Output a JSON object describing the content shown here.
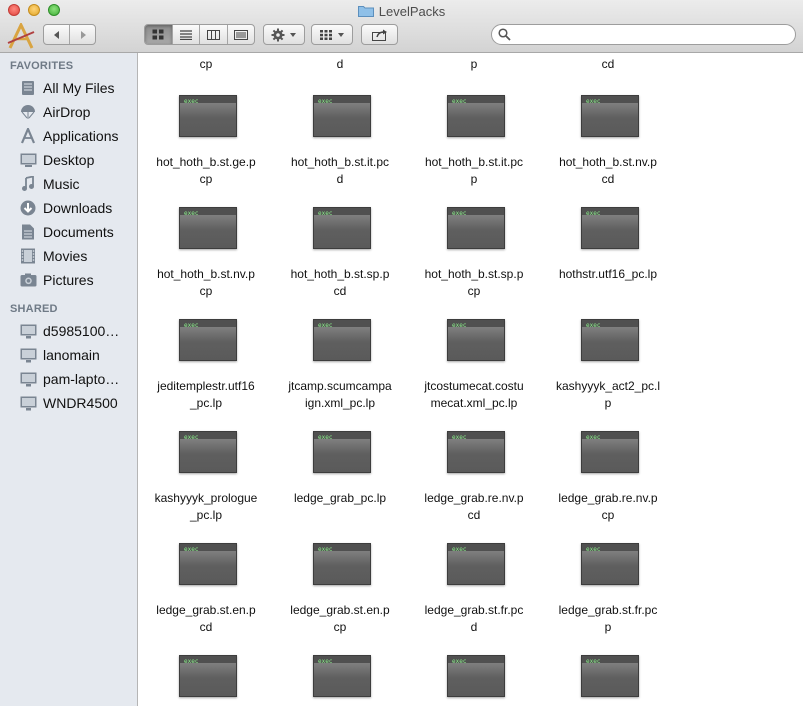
{
  "window": {
    "title": "LevelPacks"
  },
  "search": {
    "placeholder": ""
  },
  "sidebar": {
    "favorites_header": "FAVORITES",
    "favorites": [
      {
        "label": "All My Files",
        "icon": "all-files-icon"
      },
      {
        "label": "AirDrop",
        "icon": "airdrop-icon"
      },
      {
        "label": "Applications",
        "icon": "applications-icon"
      },
      {
        "label": "Desktop",
        "icon": "desktop-icon"
      },
      {
        "label": "Music",
        "icon": "music-icon"
      },
      {
        "label": "Downloads",
        "icon": "downloads-icon"
      },
      {
        "label": "Documents",
        "icon": "documents-icon"
      },
      {
        "label": "Movies",
        "icon": "movies-icon"
      },
      {
        "label": "Pictures",
        "icon": "pictures-icon"
      }
    ],
    "shared_header": "SHARED",
    "shared": [
      {
        "label": "d5985100…",
        "icon": "computer-icon"
      },
      {
        "label": "lanomain",
        "icon": "computer-icon"
      },
      {
        "label": "pam-lapto…",
        "icon": "computer-icon"
      },
      {
        "label": "WNDR4500",
        "icon": "computer-icon"
      }
    ]
  },
  "files": {
    "thumb_label": "exec",
    "top_partial": [
      {
        "line2": "cp"
      },
      {
        "line2": "d"
      },
      {
        "line2": "p"
      },
      {
        "line2": "cd"
      }
    ],
    "rows": [
      [
        {
          "line1": "hot_hoth_b.st.ge.p",
          "line2": "cp"
        },
        {
          "line1": "hot_hoth_b.st.it.pc",
          "line2": "d"
        },
        {
          "line1": "hot_hoth_b.st.it.pc",
          "line2": "p"
        },
        {
          "line1": "hot_hoth_b.st.nv.p",
          "line2": "cd"
        }
      ],
      [
        {
          "line1": "hot_hoth_b.st.nv.p",
          "line2": "cp"
        },
        {
          "line1": "hot_hoth_b.st.sp.p",
          "line2": "cd"
        },
        {
          "line1": "hot_hoth_b.st.sp.p",
          "line2": "cp"
        },
        {
          "line1": "hothstr.utf16_pc.lp",
          "line2": ""
        }
      ],
      [
        {
          "line1": "jeditemplestr.utf16",
          "line2": "_pc.lp"
        },
        {
          "line1": "jtcamp.scumcampa",
          "line2": "ign.xml_pc.lp"
        },
        {
          "line1": "jtcostumecat.costu",
          "line2": "mecat.xml_pc.lp"
        },
        {
          "line1": "kashyyyk_act2_pc.l",
          "line2": "p"
        }
      ],
      [
        {
          "line1": "kashyyyk_prologue",
          "line2": "_pc.lp"
        },
        {
          "line1": "ledge_grab_pc.lp",
          "line2": ""
        },
        {
          "line1": "ledge_grab.re.nv.p",
          "line2": "cd"
        },
        {
          "line1": "ledge_grab.re.nv.p",
          "line2": "cp"
        }
      ],
      [
        {
          "line1": "ledge_grab.st.en.p",
          "line2": "cd"
        },
        {
          "line1": "ledge_grab.st.en.p",
          "line2": "cp"
        },
        {
          "line1": "ledge_grab.st.fr.pc",
          "line2": "d"
        },
        {
          "line1": "ledge_grab.st.fr.pc",
          "line2": "p"
        }
      ]
    ],
    "bottom_partial_count": 4
  }
}
